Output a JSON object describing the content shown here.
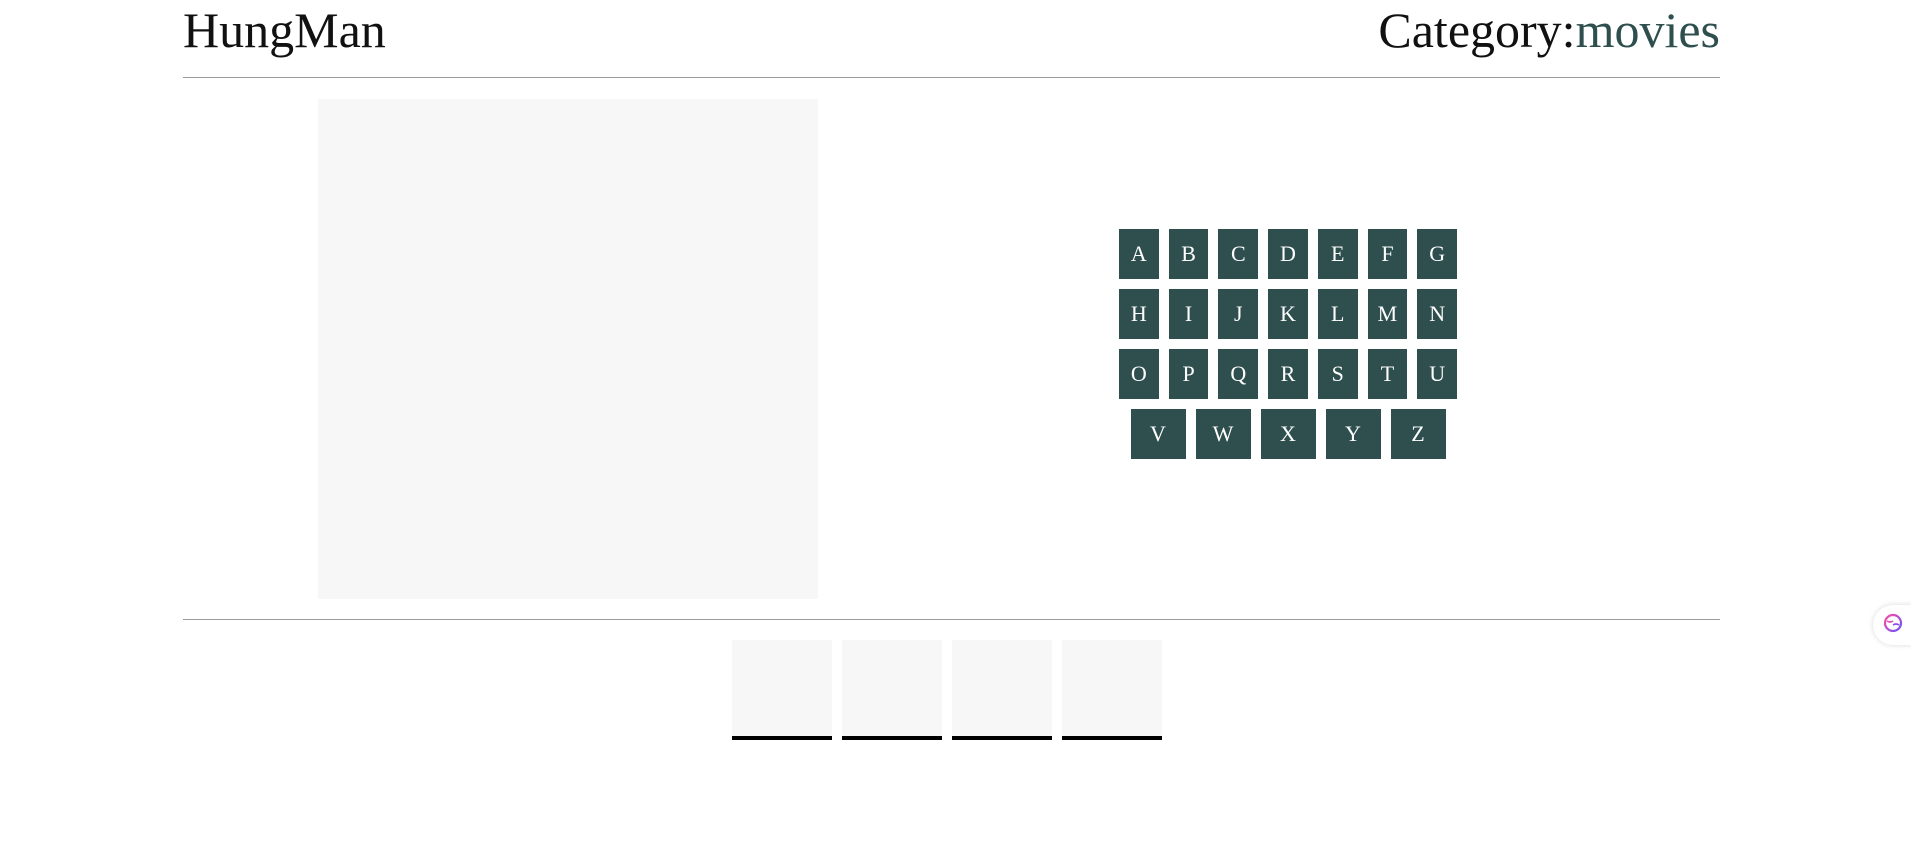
{
  "header": {
    "title": "HungMan",
    "category_label": "Category:",
    "category_value": "movies"
  },
  "keyboard": {
    "rows": [
      [
        "A",
        "B",
        "C",
        "D",
        "E",
        "F",
        "G"
      ],
      [
        "H",
        "I",
        "J",
        "K",
        "L",
        "M",
        "N"
      ],
      [
        "O",
        "P",
        "Q",
        "R",
        "S",
        "T",
        "U"
      ],
      [
        "V",
        "W",
        "X",
        "Y",
        "Z"
      ]
    ]
  },
  "word": {
    "slots": [
      "",
      "",
      "",
      ""
    ]
  },
  "colors": {
    "accent": "#2f4f4f",
    "key_text": "#ffffff",
    "panel_bg": "#f7f7f7",
    "divider": "#9a9a9a"
  },
  "floating_widget": {
    "icon": "brain-icon"
  }
}
